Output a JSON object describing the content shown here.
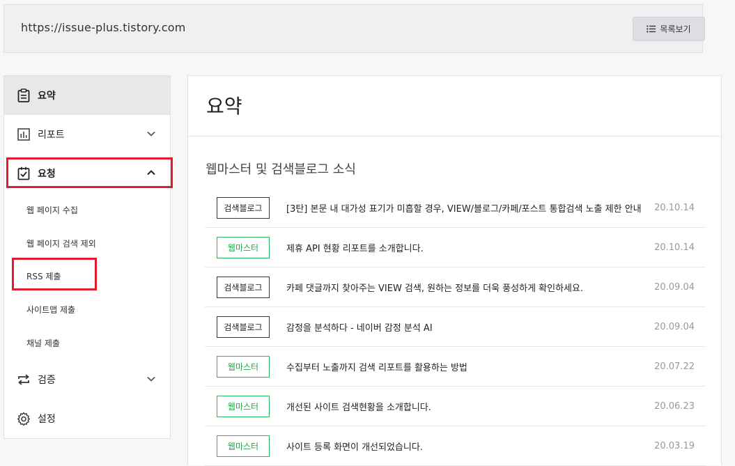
{
  "header": {
    "url": "https://issue-plus.tistory.com",
    "list_button_label": "목록보기"
  },
  "sidebar": {
    "items": [
      {
        "label": "요약",
        "icon": "clipboard-icon",
        "active": true
      },
      {
        "label": "리포트",
        "icon": "chart-icon",
        "expandable": true,
        "expanded": false
      },
      {
        "label": "요청",
        "icon": "checkbox-icon",
        "expandable": true,
        "expanded": true
      },
      {
        "label": "검증",
        "icon": "repeat-icon",
        "expandable": true,
        "expanded": false
      },
      {
        "label": "설정",
        "icon": "gear-icon"
      }
    ],
    "request_subitems": [
      "웹 페이지 수집",
      "웹 페이지 검색 제외",
      "RSS 제출",
      "사이트맵 제출",
      "채널 제출"
    ]
  },
  "highlight_color": "#e21c2a",
  "main": {
    "title": "요약",
    "section_title": "웹마스터 및 검색블로그 소식",
    "news": [
      {
        "badge": "검색블로그",
        "badge_type": "dark",
        "title": "[3탄] 본문 내 대가성 표기가 미흡할 경우, VIEW/블로그/카페/포스트 통합검색 노출 제한 안내",
        "date": "20.10.14"
      },
      {
        "badge": "웹마스터",
        "badge_type": "green",
        "title": "제휴 API 현황 리포트를 소개합니다.",
        "date": "20.10.14"
      },
      {
        "badge": "검색블로그",
        "badge_type": "dark",
        "title": "카페 댓글까지 찾아주는 VIEW 검색, 원하는 정보를 더욱 풍성하게 확인하세요.",
        "date": "20.09.04"
      },
      {
        "badge": "검색블로그",
        "badge_type": "dark",
        "title": "감정을 분석하다 - 네이버 감정 분석 AI",
        "date": "20.09.04"
      },
      {
        "badge": "웹마스터",
        "badge_type": "green",
        "title": "수집부터 노출까지 검색 리포트를 활용하는 방법",
        "date": "20.07.22"
      },
      {
        "badge": "웹마스터",
        "badge_type": "green",
        "title": "개선된 사이트 검색현황을 소개합니다.",
        "date": "20.06.23"
      },
      {
        "badge": "웹마스터",
        "badge_type": "green",
        "title": "사이트 등록 화면이 개선되었습니다.",
        "date": "20.03.19"
      }
    ]
  }
}
